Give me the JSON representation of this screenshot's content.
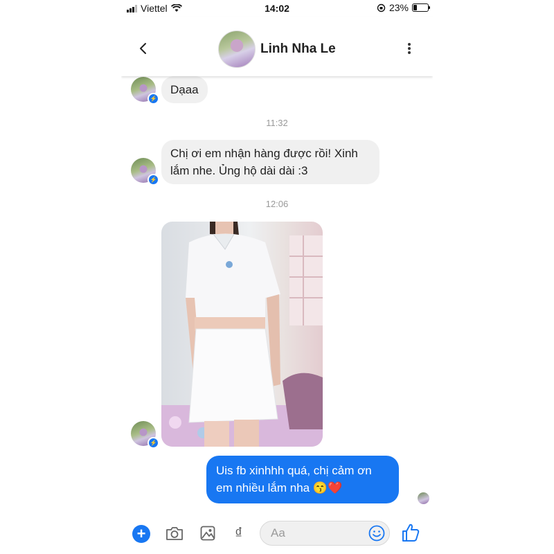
{
  "status_bar": {
    "carrier": "Viettel",
    "time": "14:02",
    "battery_percent": "23%",
    "battery_level": 0.23
  },
  "header": {
    "contact_name": "Linh Nha Le"
  },
  "messages": [
    {
      "sender": "them",
      "text": "Dạaa"
    },
    {
      "type": "timestamp",
      "text": "11:32"
    },
    {
      "sender": "them",
      "text": "Chị ơi em nhận hàng được rồi! Xinh lắm nhe. Ủng hộ dài dài :3"
    },
    {
      "type": "timestamp",
      "text": "12:06"
    },
    {
      "sender": "them",
      "type": "photo"
    },
    {
      "sender": "me",
      "text": "Uis fb xinhhh quá, chị cảm ơn em nhiều lắm nha 😙❤️"
    }
  ],
  "composer": {
    "placeholder": "Aa",
    "currency_symbol": "₫"
  },
  "colors": {
    "accent": "#1877f2",
    "incoming_bubble": "#f0f0f0",
    "timestamp_text": "#999999"
  },
  "icons": [
    "back-icon",
    "more-icon",
    "messenger-badge-icon",
    "plus-icon",
    "camera-icon",
    "gallery-icon",
    "emoji-icon",
    "like-icon"
  ]
}
